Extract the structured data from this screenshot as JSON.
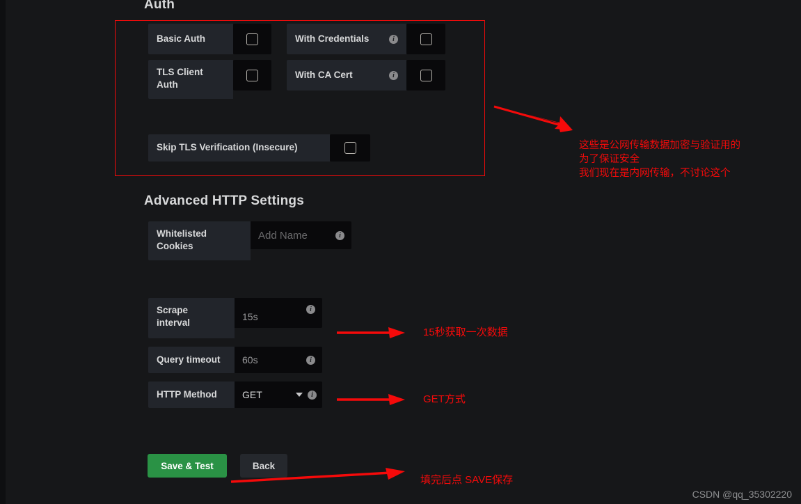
{
  "page": {
    "background": "#161719",
    "accent_red": "#f50a0a",
    "green": "#2a9245"
  },
  "auth_section": {
    "heading": "Auth",
    "rows": [
      {
        "label": "Basic Auth",
        "second_label": "With Credentials",
        "has_info": true
      },
      {
        "label": "TLS Client Auth",
        "label_line1": "TLS Client",
        "label_line2": "Auth",
        "second_label": "With CA Cert",
        "has_info": true
      },
      {
        "label": "Skip TLS Verification (Insecure)",
        "has_info": false
      }
    ]
  },
  "advanced_section": {
    "heading": "Advanced HTTP Settings",
    "whitelisted_cookies": {
      "label_line1": "Whitelisted",
      "label_line2": "Cookies",
      "placeholder": "Add Name"
    },
    "scrape_interval": {
      "label_line1": "Scrape",
      "label_line2": "interval",
      "value": "15s"
    },
    "query_timeout": {
      "label": "Query timeout",
      "value": "60s"
    },
    "http_method": {
      "label": "HTTP Method",
      "value": "GET"
    }
  },
  "buttons": {
    "save_test": "Save & Test",
    "back": "Back"
  },
  "annotations": {
    "auth_note": "这些是公网传输数据加密与验证用的\n为了保证安全\n我们现在是内网传输，不讨论这个",
    "scrape_note": "15秒获取一次数据",
    "method_note": "GET方式",
    "save_note": "填完后点 SAVE保存"
  },
  "watermark": "CSDN @qq_35302220",
  "icons": {
    "info": "i"
  }
}
